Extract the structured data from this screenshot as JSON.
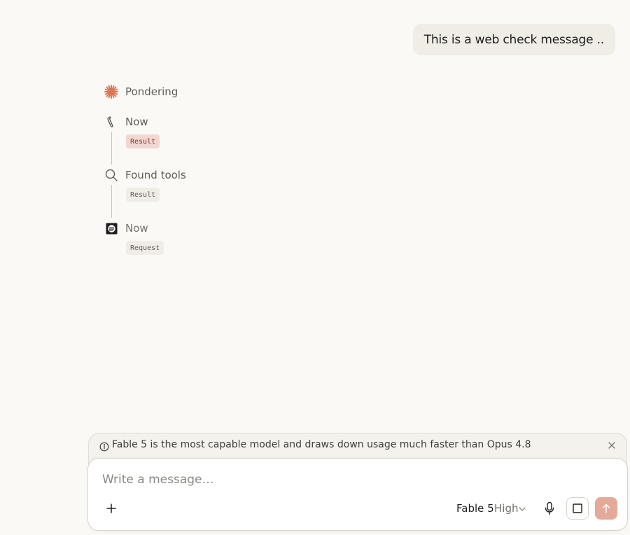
{
  "conversation": {
    "user_message": "This is a web check message .."
  },
  "timeline": {
    "steps": [
      {
        "icon": "sparkle-icon",
        "label": "Pondering"
      },
      {
        "icon": "wrench-icon",
        "label": "Now",
        "badge": "Result"
      },
      {
        "icon": "search-icon",
        "label": "Found tools",
        "badge": "Result"
      },
      {
        "icon": "browser-tool-icon",
        "label": "Now",
        "badge": "Request"
      }
    ]
  },
  "notice": {
    "text": "Fable 5 is the most capable model and draws down usage much faster than Opus 4.8"
  },
  "composer": {
    "placeholder": "Write a message…",
    "model": "Fable 5",
    "effort": "High"
  },
  "colors": {
    "accent": "#d97757",
    "send_button": "#e5a99a",
    "result_badge_red": "#f3d6d2"
  }
}
